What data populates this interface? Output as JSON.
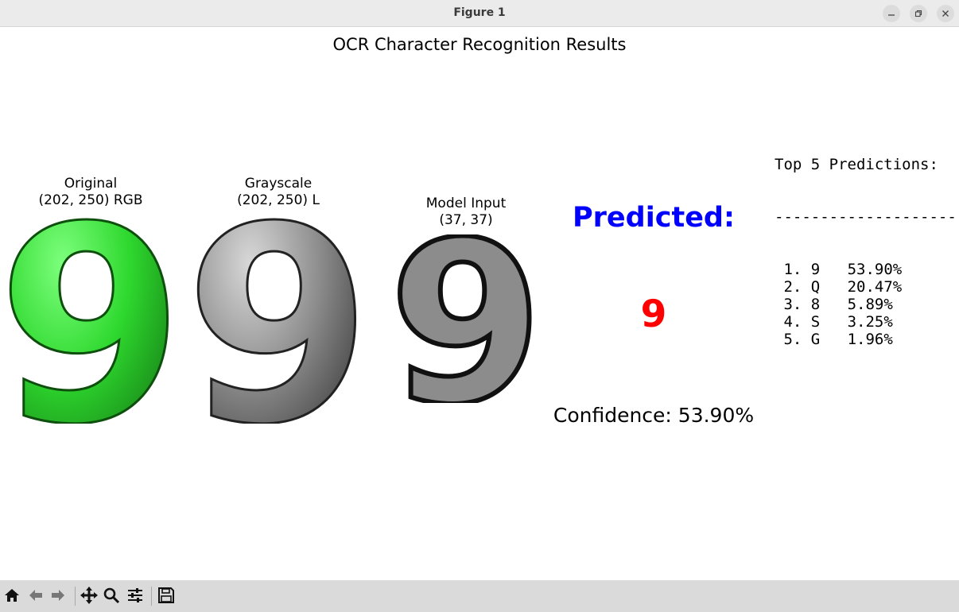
{
  "window": {
    "title": "Figure 1",
    "controls": [
      "minimize-icon",
      "restore-icon",
      "close-icon"
    ]
  },
  "figure": {
    "title": "OCR Character Recognition Results",
    "panels": [
      {
        "title": "Original",
        "subtitle": "(202, 250) RGB",
        "glyph": "9",
        "color": "#2ecc40"
      },
      {
        "title": "Grayscale",
        "subtitle": "(202, 250) L",
        "glyph": "9",
        "color": "#8a8a8a"
      },
      {
        "title": "Model Input",
        "subtitle": "(37, 37)",
        "glyph": "9",
        "color": "#8a8a8a"
      }
    ],
    "prediction": {
      "label": "Predicted:",
      "value": "9",
      "confidence_text": "Confidence: 53.90%",
      "label_color": "#0000ff",
      "value_color": "#ff0000"
    },
    "top5": {
      "header": "Top 5 Predictions:",
      "separator": "--------------------",
      "items": [
        {
          "rank": "1.",
          "char": "9",
          "prob": "53.90%"
        },
        {
          "rank": "2.",
          "char": "Q",
          "prob": "20.47%"
        },
        {
          "rank": "3.",
          "char": "8",
          "prob": "5.89%"
        },
        {
          "rank": "4.",
          "char": "S",
          "prob": "3.25%"
        },
        {
          "rank": "5.",
          "char": "G",
          "prob": "1.96%"
        }
      ]
    }
  },
  "toolbar": {
    "buttons": [
      "home-icon",
      "back-icon",
      "forward-icon",
      "pan-icon",
      "zoom-icon",
      "configure-icon",
      "save-icon"
    ]
  }
}
